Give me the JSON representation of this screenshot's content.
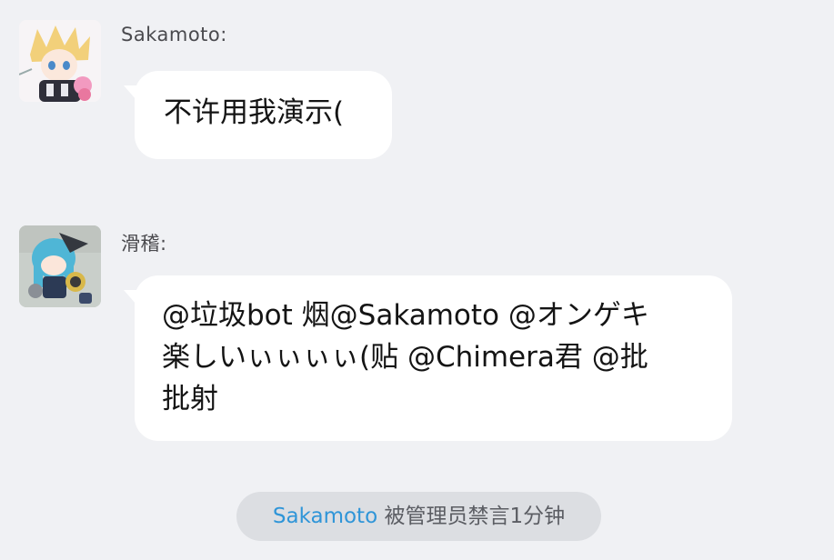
{
  "messages": [
    {
      "sender": "Sakamoto:",
      "text": "不许用我演示(",
      "avatar_icon": "anime-character-avatar-icon"
    },
    {
      "sender": "滑稽:",
      "lines": [
        "@垃圾bot 烟@Sakamoto @オンゲキ",
        "楽しいぃぃぃぃ(贴 @Chimera君 @批",
        "批射"
      ],
      "avatar_icon": "plush-doll-avatar-icon"
    }
  ],
  "system": {
    "user": "Sakamoto",
    "text": " 被管理员禁言1分钟"
  },
  "colors": {
    "background": "#f0f1f4",
    "bubble": "#ffffff",
    "link": "#2f95d8",
    "pill": "#dcdee2"
  }
}
